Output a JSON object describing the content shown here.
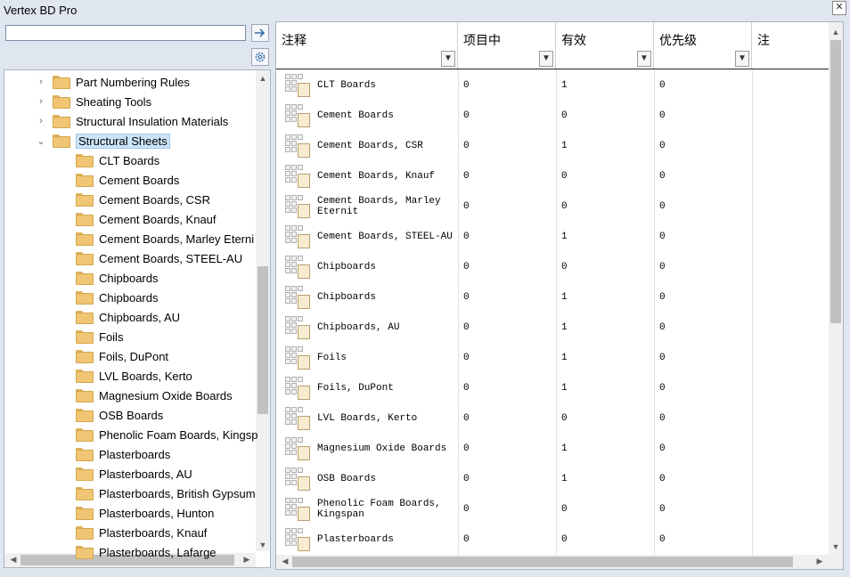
{
  "window": {
    "title": "Vertex BD Pro",
    "close_glyph": "✕"
  },
  "toolbar": {
    "search_value": "",
    "go_icon": "arrow-right-icon",
    "settings_icon": "gear-icon"
  },
  "tree": {
    "items": [
      {
        "label": "Part Numbering Rules",
        "level": 0,
        "expand": "›"
      },
      {
        "label": "Sheating Tools",
        "level": 0,
        "expand": "›"
      },
      {
        "label": "Structural Insulation Materials",
        "level": 0,
        "expand": "›"
      },
      {
        "label": "Structural Sheets",
        "level": 0,
        "expand": "⌄",
        "selected": true
      },
      {
        "label": "CLT Boards",
        "level": 1
      },
      {
        "label": "Cement Boards",
        "level": 1
      },
      {
        "label": "Cement Boards, CSR",
        "level": 1
      },
      {
        "label": "Cement Boards, Knauf",
        "level": 1
      },
      {
        "label": "Cement Boards, Marley Eterni",
        "level": 1
      },
      {
        "label": "Cement Boards, STEEL-AU",
        "level": 1
      },
      {
        "label": "Chipboards",
        "level": 1
      },
      {
        "label": "Chipboards",
        "level": 1
      },
      {
        "label": "Chipboards, AU",
        "level": 1
      },
      {
        "label": "Foils",
        "level": 1
      },
      {
        "label": "Foils, DuPont",
        "level": 1
      },
      {
        "label": "LVL Boards, Kerto",
        "level": 1
      },
      {
        "label": "Magnesium Oxide Boards",
        "level": 1
      },
      {
        "label": "OSB Boards",
        "level": 1
      },
      {
        "label": "Phenolic Foam Boards, Kingsp",
        "level": 1
      },
      {
        "label": "Plasterboards",
        "level": 1
      },
      {
        "label": "Plasterboards, AU",
        "level": 1
      },
      {
        "label": "Plasterboards, British Gypsum",
        "level": 1
      },
      {
        "label": "Plasterboards, Hunton",
        "level": 1
      },
      {
        "label": "Plasterboards, Knauf",
        "level": 1
      },
      {
        "label": "Plasterboards, Lafarge",
        "level": 1
      }
    ]
  },
  "grid": {
    "columns": [
      "注释",
      "项目中",
      "有效",
      "优先级",
      "注"
    ],
    "filter_glyph": "▼",
    "rows": [
      {
        "name": "CLT Boards",
        "in_project": "0",
        "valid": "1",
        "priority": "0"
      },
      {
        "name": "Cement Boards",
        "in_project": "0",
        "valid": "0",
        "priority": "0"
      },
      {
        "name": "Cement Boards, CSR",
        "in_project": "0",
        "valid": "1",
        "priority": "0"
      },
      {
        "name": "Cement Boards, Knauf",
        "in_project": "0",
        "valid": "0",
        "priority": "0"
      },
      {
        "name": "Cement Boards, Marley\nEternit",
        "in_project": "0",
        "valid": "0",
        "priority": "0"
      },
      {
        "name": "Cement Boards, STEEL-AU",
        "in_project": "0",
        "valid": "1",
        "priority": "0"
      },
      {
        "name": "Chipboards",
        "in_project": "0",
        "valid": "0",
        "priority": "0"
      },
      {
        "name": "Chipboards",
        "in_project": "0",
        "valid": "1",
        "priority": "0"
      },
      {
        "name": "Chipboards, AU",
        "in_project": "0",
        "valid": "1",
        "priority": "0"
      },
      {
        "name": "Foils",
        "in_project": "0",
        "valid": "1",
        "priority": "0"
      },
      {
        "name": "Foils, DuPont",
        "in_project": "0",
        "valid": "1",
        "priority": "0"
      },
      {
        "name": "LVL Boards, Kerto",
        "in_project": "0",
        "valid": "0",
        "priority": "0"
      },
      {
        "name": "Magnesium Oxide Boards",
        "in_project": "0",
        "valid": "1",
        "priority": "0"
      },
      {
        "name": "OSB Boards",
        "in_project": "0",
        "valid": "1",
        "priority": "0"
      },
      {
        "name": "Phenolic Foam Boards,\nKingspan",
        "in_project": "0",
        "valid": "0",
        "priority": "0"
      },
      {
        "name": "Plasterboards",
        "in_project": "0",
        "valid": "0",
        "priority": "0"
      }
    ]
  },
  "colors": {
    "selection": "#cce4f7",
    "folder": "#f0c674",
    "chrome": "#dfe6f0"
  }
}
